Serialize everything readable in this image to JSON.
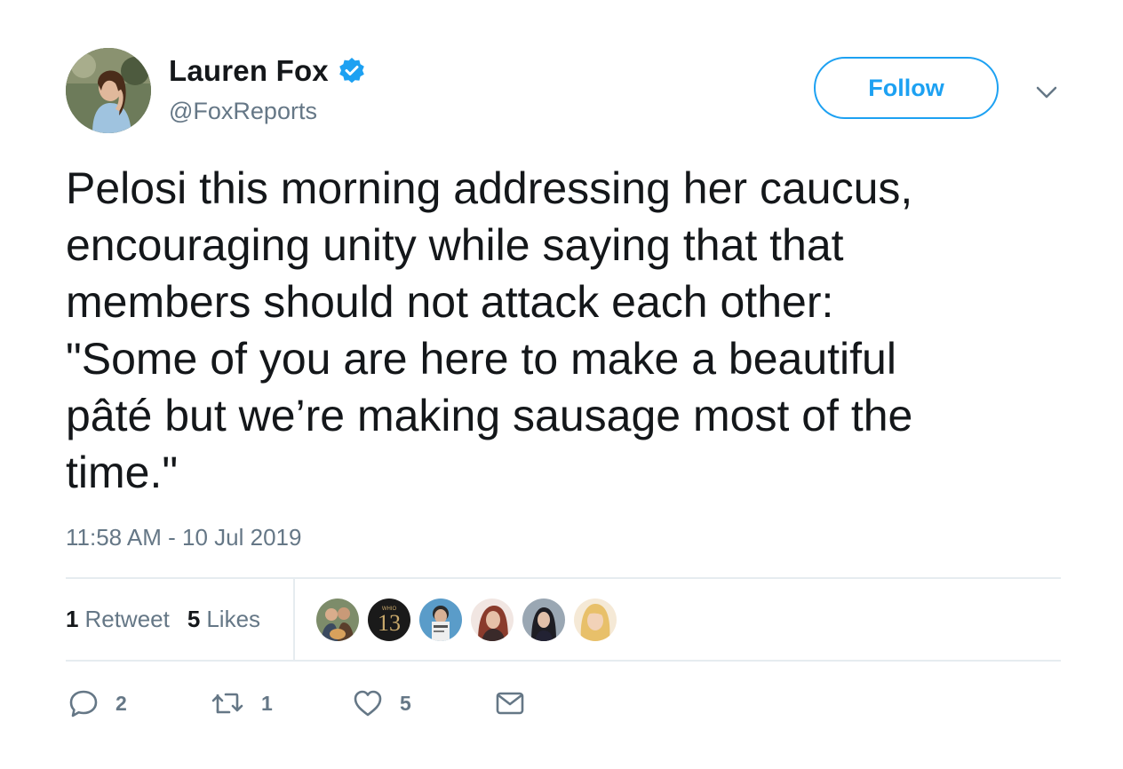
{
  "author": {
    "display_name": "Lauren Fox",
    "handle": "@FoxReports",
    "verified": true,
    "avatar_icon": "profile-photo"
  },
  "header": {
    "follow_label": "Follow",
    "more_icon": "chevron-down-icon"
  },
  "tweet": {
    "text": "Pelosi this morning addressing her caucus,\nencouraging unity while saying that that\nmembers should not attack each other:\n\"Some of you are here to make a beautiful\npâté but we’re making sausage most of the\ntime.\"",
    "timestamp": "11:58 AM - 10 Jul 2019"
  },
  "stats": {
    "retweets_count": "1",
    "retweets_label": "Retweet",
    "likes_count": "5",
    "likes_label": "Likes"
  },
  "likers": [
    {
      "icon": "liker-avatar-1"
    },
    {
      "icon": "liker-avatar-2"
    },
    {
      "icon": "liker-avatar-3"
    },
    {
      "icon": "liker-avatar-4"
    },
    {
      "icon": "liker-avatar-5"
    },
    {
      "icon": "liker-avatar-6"
    }
  ],
  "actions": {
    "reply_count": "2",
    "retweet_count": "1",
    "like_count": "5"
  },
  "colors": {
    "accent": "#1da1f2",
    "text": "#14171a",
    "secondary": "#657786",
    "divider": "#e6ecf0"
  }
}
